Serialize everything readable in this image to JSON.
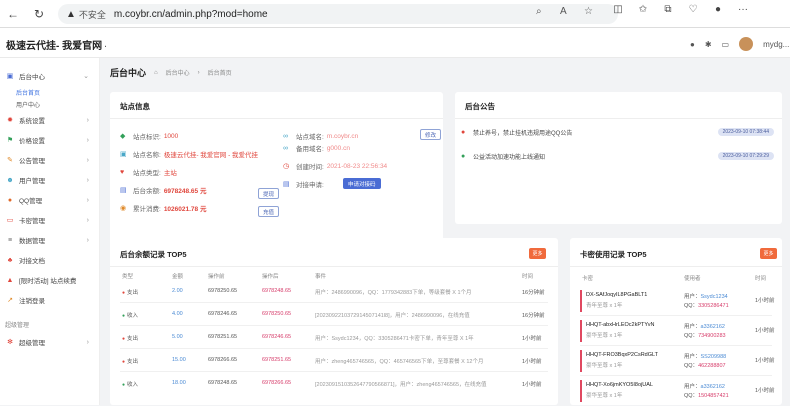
{
  "browser": {
    "warning_icon": "warning-triangle",
    "not_secure": "不安全",
    "url": "m.coybr.cn/admin.php?mod=home"
  },
  "app": {
    "brand": "极速云代挂- 我爱官网 - 我",
    "user_name": "mydg..."
  },
  "sidebar": {
    "items": [
      {
        "label": "后台中心",
        "icon": "monitor-icon",
        "expanded": true
      },
      {
        "label": "系统设置",
        "icon": "gear-icon"
      },
      {
        "label": "价格设置",
        "icon": "flag-icon"
      },
      {
        "label": "公告管理",
        "icon": "megaphone-icon"
      },
      {
        "label": "用户管理",
        "icon": "users-icon"
      },
      {
        "label": "QQ管理",
        "icon": "qq-icon"
      },
      {
        "label": "卡密管理",
        "icon": "card-icon"
      },
      {
        "label": "数据管理",
        "icon": "data-icon"
      },
      {
        "label": "对接文档",
        "icon": "doc-icon"
      },
      {
        "label": "[限时活动] 站点续费",
        "icon": "gift-icon"
      },
      {
        "label": "注销登录",
        "icon": "logout-icon"
      }
    ],
    "subitems": [
      "后台首页",
      "用户中心"
    ],
    "group_label": "超级管理",
    "last_item": {
      "label": "超级管理",
      "icon": "settings-icon"
    }
  },
  "page": {
    "title": "后台中心",
    "breadcrumb": [
      "后台中心",
      "后台首页"
    ]
  },
  "site_info": {
    "title": "站点信息",
    "left": [
      {
        "key": "站点标识:",
        "value": "1000",
        "icon": "tag-icon",
        "color": "#e0463c"
      },
      {
        "key": "站点名称:",
        "value": "极速云代挂- 我爱官网 - 我爱代挂",
        "icon": "id-icon",
        "color": "#e0463c"
      },
      {
        "key": "站点类型:",
        "value": "主站",
        "icon": "type-icon",
        "color": "#e0463c"
      },
      {
        "key": "后台余额:",
        "value": "6978248.65 元",
        "icon": "wallet-icon",
        "color": "#e0463c"
      },
      {
        "key": "累计消费:",
        "value": "1026021.78 元",
        "icon": "eye-icon",
        "color": "#e0463c"
      }
    ],
    "right": [
      {
        "key": "站点域名:",
        "value": "m.coybr.cn",
        "icon": "link-icon",
        "color": "#f08a8a"
      },
      {
        "key": "备用域名:",
        "value": "g000.cn",
        "icon": "link-icon",
        "color": "#f08a8a"
      },
      {
        "key": "创建时间:",
        "value": "2021-08-23 22:56:34",
        "icon": "clock-icon",
        "color": "#f08a8a"
      },
      {
        "key": "对接申请:",
        "value": "",
        "icon": "plug-icon",
        "color": "#333333"
      }
    ],
    "buttons": {
      "modify": "修改",
      "recharge": "提现",
      "recharge2": "充值",
      "apply": "申请对接码"
    }
  },
  "notice": {
    "title": "后台公告",
    "items": [
      {
        "text": "禁止养号，禁止挂机违规用途QQ公告",
        "time": "2023-09-10 07:38:44",
        "icon": "comment-red-icon"
      },
      {
        "text": "公益活动加速功能上线通知",
        "time": "2023-09-10 07:29:29",
        "icon": "comment-green-icon"
      }
    ]
  },
  "balance_log": {
    "title": "后台余额记录 TOP5",
    "more": "更多",
    "headers": [
      "类型",
      "金额",
      "操作前",
      "操作后",
      "事件",
      "时间"
    ],
    "rows": [
      {
        "type": "支出",
        "kind": "out",
        "amount": "2.00",
        "before": "6978250.65",
        "after": "6978248.65",
        "event": "用户：2486990096，QQ：1779342883下单，等级套餐 X 1个月",
        "time": "16分钟前"
      },
      {
        "type": "收入",
        "kind": "in",
        "amount": "4.00",
        "before": "6978246.65",
        "after": "6978250.65",
        "event": "[2023092210372914507141l8]，用户：2486990096，在线充值",
        "time": "16分钟前"
      },
      {
        "type": "支出",
        "kind": "out",
        "amount": "5.00",
        "before": "6978251.65",
        "after": "6978246.65",
        "event": "用户：Ssydc1234，QQ：3305286471卡密下单，青年至尊 X 1年",
        "time": "1小时前"
      },
      {
        "type": "支出",
        "kind": "out",
        "amount": "15.00",
        "before": "6978266.65",
        "after": "6978251.65",
        "event": "用户：zheng465746565，QQ：465746565下单，至尊套餐 X 12个月",
        "time": "1小时前"
      },
      {
        "type": "收入",
        "kind": "in",
        "amount": "18.00",
        "before": "6978248.65",
        "after": "6978266.65",
        "event": "[2023091510352647790566871]，用户：zheng465746565，在线充值",
        "time": "1小时前"
      }
    ]
  },
  "card_log": {
    "title": "卡密使用记录 TOP5",
    "more": "更多",
    "headers": [
      "卡密",
      "使用者",
      "时间"
    ],
    "rows": [
      {
        "card": "DX-SAfJoqyIL8PGaBLT1",
        "desc": "青年至尊 x 1年",
        "user": "Ssydc1234",
        "qq": "3305286471",
        "time": "1小时前"
      },
      {
        "card": "HHQT-abxHrLEOc2kPTYvN",
        "desc": "豪华至尊 x 1年",
        "user": "a3362162",
        "qq": "734900283",
        "time": "1小时前"
      },
      {
        "card": "HHQT-FRO3BqxP2CsRdGLT",
        "desc": "豪华至尊 x 1年",
        "user": "SS209988",
        "qq": "462288807",
        "time": "1小时前"
      },
      {
        "card": "HHQT-Xo6jmKYO5I8ojUAL",
        "desc": "豪华至尊 x 1年",
        "user": "a3362162",
        "qq": "1504857421",
        "time": "1小时前"
      }
    ],
    "user_prefix": "用户：",
    "qq_prefix": "QQ："
  }
}
